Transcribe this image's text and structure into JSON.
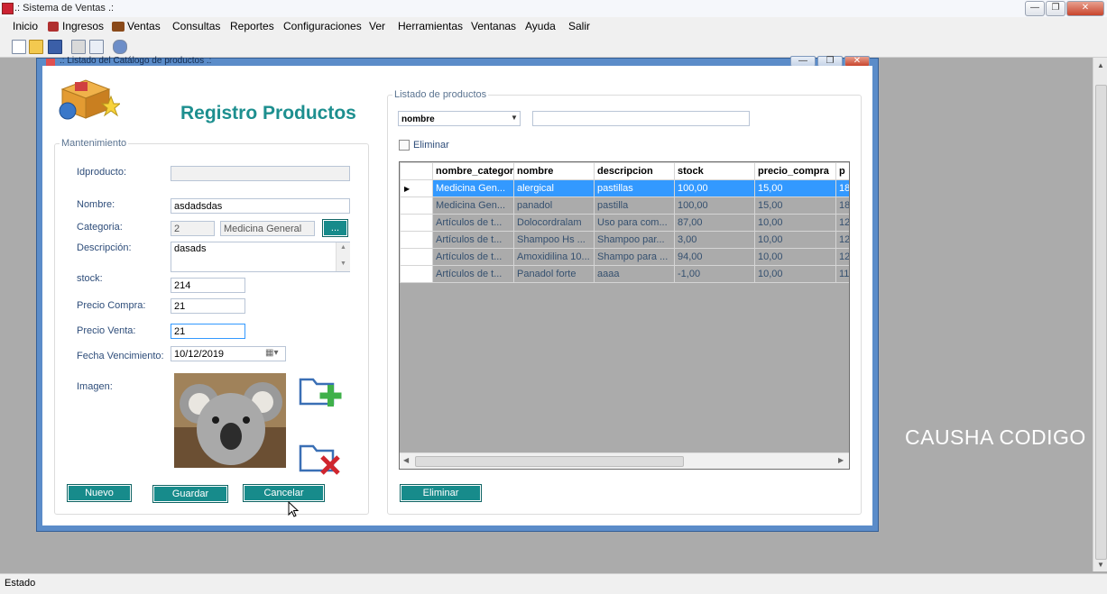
{
  "app": {
    "title": ".: Sistema de Ventas .:",
    "status": "Estado",
    "watermark": "CAUSHA CODIGO"
  },
  "menu": [
    "Inicio",
    "Ingresos",
    "Ventas",
    "Consultas",
    "Reportes",
    "Configuraciones",
    "Ver",
    "Herramientas",
    "Ventanas",
    "Ayuda",
    "Salir"
  ],
  "child": {
    "title": ".: Listado del Catálogo de productos .:"
  },
  "form": {
    "heading": "Registro Productos",
    "group_label": "Mantenimiento",
    "id_label": "Idproducto:",
    "id_value": "",
    "nombre_label": "Nombre:",
    "nombre_value": "asdadsdas",
    "categoria_label": "Categoria:",
    "categoria_id": "2",
    "categoria_name": "Medicina General",
    "categoria_btn": "...",
    "descripcion_label": "Descripción:",
    "descripcion_value": "dasads",
    "stock_label": "stock:",
    "stock_value": "214",
    "compra_label": "Precio Compra:",
    "compra_value": "21",
    "venta_label": "Precio Venta:",
    "venta_value": "21",
    "fecha_label": "Fecha Vencimiento:",
    "fecha_value": "10/12/2019",
    "imagen_label": "Imagen:",
    "nuevo": "Nuevo",
    "guardar": "Guardar",
    "cancelar": "Cancelar"
  },
  "listado": {
    "group_label": "Listado de productos",
    "search_field": "nombre",
    "search_value": "",
    "eliminar_check": "Eliminar",
    "eliminar_btn": "Eliminar",
    "columns": [
      "nombre_categor",
      "nombre",
      "descripcion",
      "stock",
      "precio_compra",
      "p"
    ],
    "rows": [
      [
        "Medicina Gen...",
        "alergical",
        "pastillas",
        "100,00",
        "15,00",
        "18"
      ],
      [
        "Medicina Gen...",
        "panadol",
        "pastilla",
        "100,00",
        "15,00",
        "18"
      ],
      [
        "Artículos de t...",
        "Dolocordralam",
        "Uso para com...",
        "87,00",
        "10,00",
        "12"
      ],
      [
        "Artículos de t...",
        "Shampoo Hs ...",
        "Shampoo par...",
        "3,00",
        "10,00",
        "12"
      ],
      [
        "Artículos de t...",
        "Amoxidilina 10...",
        "Shampo para ...",
        "94,00",
        "10,00",
        "12"
      ],
      [
        "Artículos de t...",
        "Panadol forte",
        "aaaa",
        "-1,00",
        "10,00",
        "11"
      ]
    ],
    "selected_row": 0
  }
}
